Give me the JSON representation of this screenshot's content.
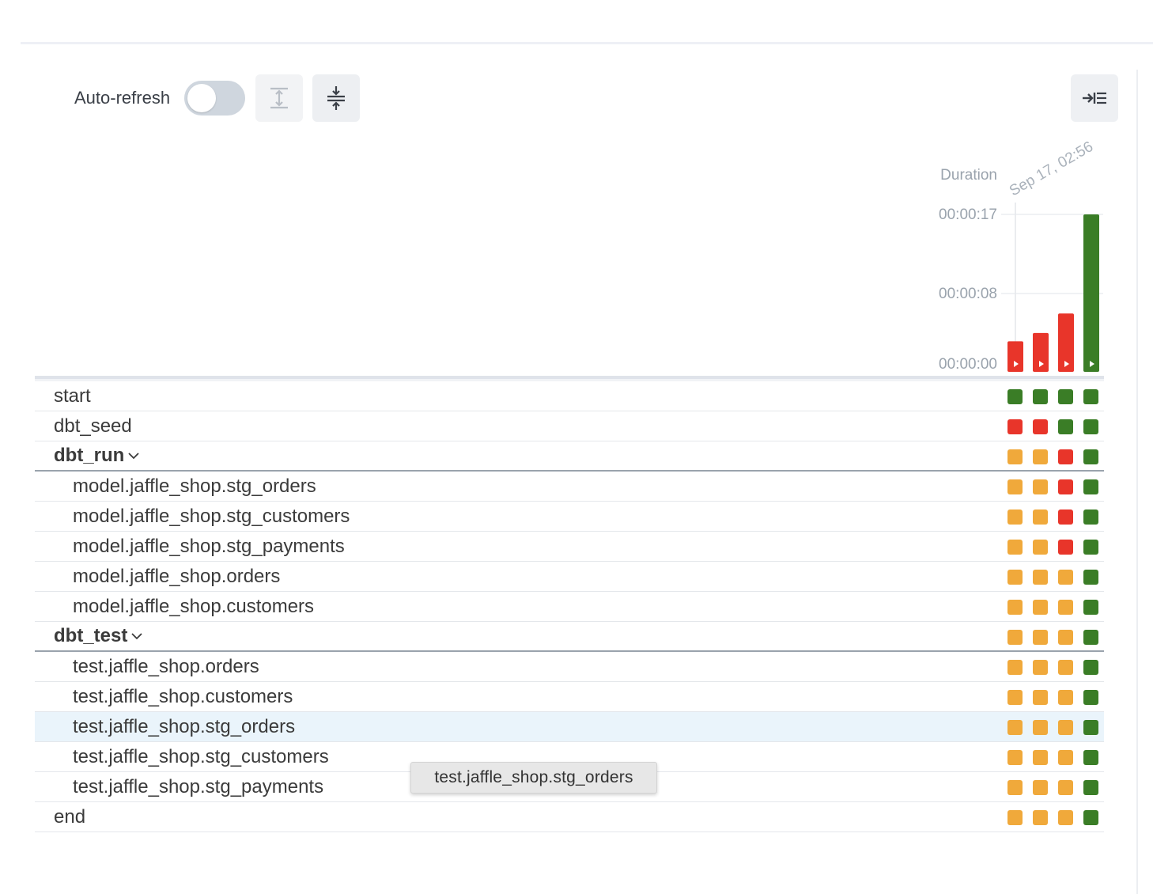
{
  "toolbar": {
    "auto_refresh_label": "Auto-refresh",
    "auto_refresh_on": false,
    "expand_all_icon": "expand-vertical-icon",
    "collapse_all_icon": "collapse-vertical-icon",
    "toggle_panel_icon": "arrow-right-to-list-icon"
  },
  "colors": {
    "success": "#3a7d26",
    "failed": "#e8352a",
    "upstream_failed": "#f0a93b"
  },
  "chart_data": {
    "type": "bar",
    "ylabel": "Duration",
    "yticks": [
      "00:00:17",
      "00:00:08",
      "00:00:00"
    ],
    "ylim_seconds": [
      0,
      17
    ],
    "date_label": "Sep 17, 02:56",
    "values_seconds": [
      3.3,
      4.2,
      6.3,
      17
    ],
    "states": [
      "failed",
      "failed",
      "failed",
      "success"
    ]
  },
  "rows": [
    {
      "label": "start",
      "level": 0,
      "group": false,
      "states": [
        "success",
        "success",
        "success",
        "success"
      ]
    },
    {
      "label": "dbt_seed",
      "level": 0,
      "group": false,
      "states": [
        "failed",
        "failed",
        "success",
        "success"
      ]
    },
    {
      "label": "dbt_run",
      "level": 0,
      "group": true,
      "states": [
        "upstream_failed",
        "upstream_failed",
        "failed",
        "success"
      ]
    },
    {
      "label": "model.jaffle_shop.stg_orders",
      "level": 1,
      "group": false,
      "states": [
        "upstream_failed",
        "upstream_failed",
        "failed",
        "success"
      ]
    },
    {
      "label": "model.jaffle_shop.stg_customers",
      "level": 1,
      "group": false,
      "states": [
        "upstream_failed",
        "upstream_failed",
        "failed",
        "success"
      ]
    },
    {
      "label": "model.jaffle_shop.stg_payments",
      "level": 1,
      "group": false,
      "states": [
        "upstream_failed",
        "upstream_failed",
        "failed",
        "success"
      ]
    },
    {
      "label": "model.jaffle_shop.orders",
      "level": 1,
      "group": false,
      "states": [
        "upstream_failed",
        "upstream_failed",
        "upstream_failed",
        "success"
      ]
    },
    {
      "label": "model.jaffle_shop.customers",
      "level": 1,
      "group": false,
      "states": [
        "upstream_failed",
        "upstream_failed",
        "upstream_failed",
        "success"
      ]
    },
    {
      "label": "dbt_test",
      "level": 0,
      "group": true,
      "states": [
        "upstream_failed",
        "upstream_failed",
        "upstream_failed",
        "success"
      ]
    },
    {
      "label": "test.jaffle_shop.orders",
      "level": 1,
      "group": false,
      "states": [
        "upstream_failed",
        "upstream_failed",
        "upstream_failed",
        "success"
      ]
    },
    {
      "label": "test.jaffle_shop.customers",
      "level": 1,
      "group": false,
      "states": [
        "upstream_failed",
        "upstream_failed",
        "upstream_failed",
        "success"
      ]
    },
    {
      "label": "test.jaffle_shop.stg_orders",
      "level": 1,
      "group": false,
      "highlight": true,
      "states": [
        "upstream_failed",
        "upstream_failed",
        "upstream_failed",
        "success"
      ]
    },
    {
      "label": "test.jaffle_shop.stg_customers",
      "level": 1,
      "group": false,
      "states": [
        "upstream_failed",
        "upstream_failed",
        "upstream_failed",
        "success"
      ]
    },
    {
      "label": "test.jaffle_shop.stg_payments",
      "level": 1,
      "group": false,
      "states": [
        "upstream_failed",
        "upstream_failed",
        "upstream_failed",
        "success"
      ]
    },
    {
      "label": "end",
      "level": 0,
      "group": false,
      "states": [
        "upstream_failed",
        "upstream_failed",
        "upstream_failed",
        "success"
      ]
    }
  ],
  "tooltip": {
    "text": "test.jaffle_shop.stg_orders"
  }
}
